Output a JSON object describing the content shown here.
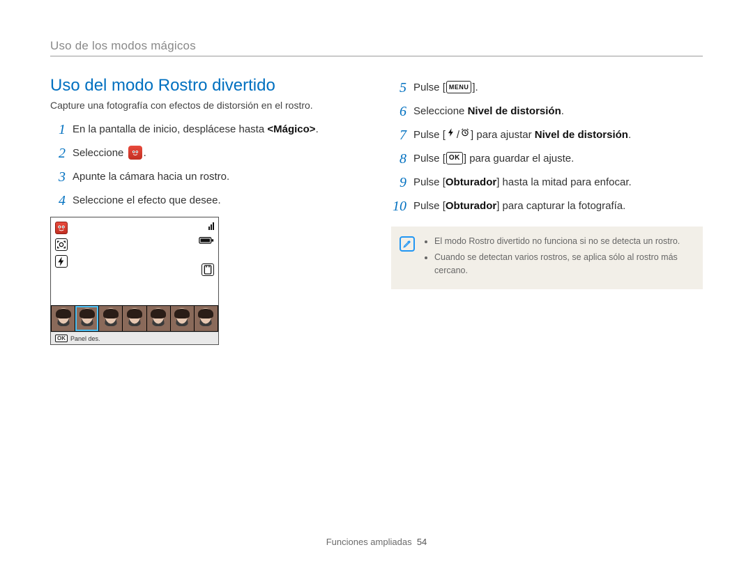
{
  "chapter_title": "Uso de los modos mágicos",
  "section_title": "Uso del modo Rostro divertido",
  "intro": "Capture una fotografía con efectos de distorsión en el rostro.",
  "left_steps": [
    {
      "n": "1",
      "pre": "En la pantalla de inicio, desplácese hasta ",
      "bold": "<Mágico>",
      "post": "."
    },
    {
      "n": "2",
      "pre": "Seleccione ",
      "icon": "funny-face",
      "post": "."
    },
    {
      "n": "3",
      "pre": "Apunte la cámara hacia un rostro."
    },
    {
      "n": "4",
      "pre": "Seleccione el efecto que desee."
    }
  ],
  "right_steps": [
    {
      "n": "5",
      "pre": "Pulse [",
      "btn": "MENU",
      "post": "]."
    },
    {
      "n": "6",
      "pre": "Seleccione ",
      "bold": "Nivel de distorsión",
      "post": "."
    },
    {
      "n": "7",
      "pre": "Pulse [",
      "icons": [
        "flash",
        "timer"
      ],
      "post_after_icons": "] para ajustar ",
      "bold": "Nivel de distorsión",
      "post": "."
    },
    {
      "n": "8",
      "pre": "Pulse [",
      "btn": "OK",
      "post": "] para guardar el ajuste."
    },
    {
      "n": "9",
      "pre": "Pulse [",
      "bold": "Obturador",
      "post": "] hasta la mitad para enfocar."
    },
    {
      "n": "10",
      "pre": "Pulse [",
      "bold": "Obturador",
      "post": "] para capturar la fotografía."
    }
  ],
  "notes": [
    "El modo Rostro divertido no funciona si no se detecta un rostro.",
    "Cuando se detectan varios rostros, se aplica sólo al rostro más cercano."
  ],
  "camshot": {
    "footer_ok": "OK",
    "footer_label": "Panel des.",
    "thumbs_count": 7,
    "selected_thumb_index": 1
  },
  "footer": {
    "label": "Funciones ampliadas",
    "page": "54"
  }
}
